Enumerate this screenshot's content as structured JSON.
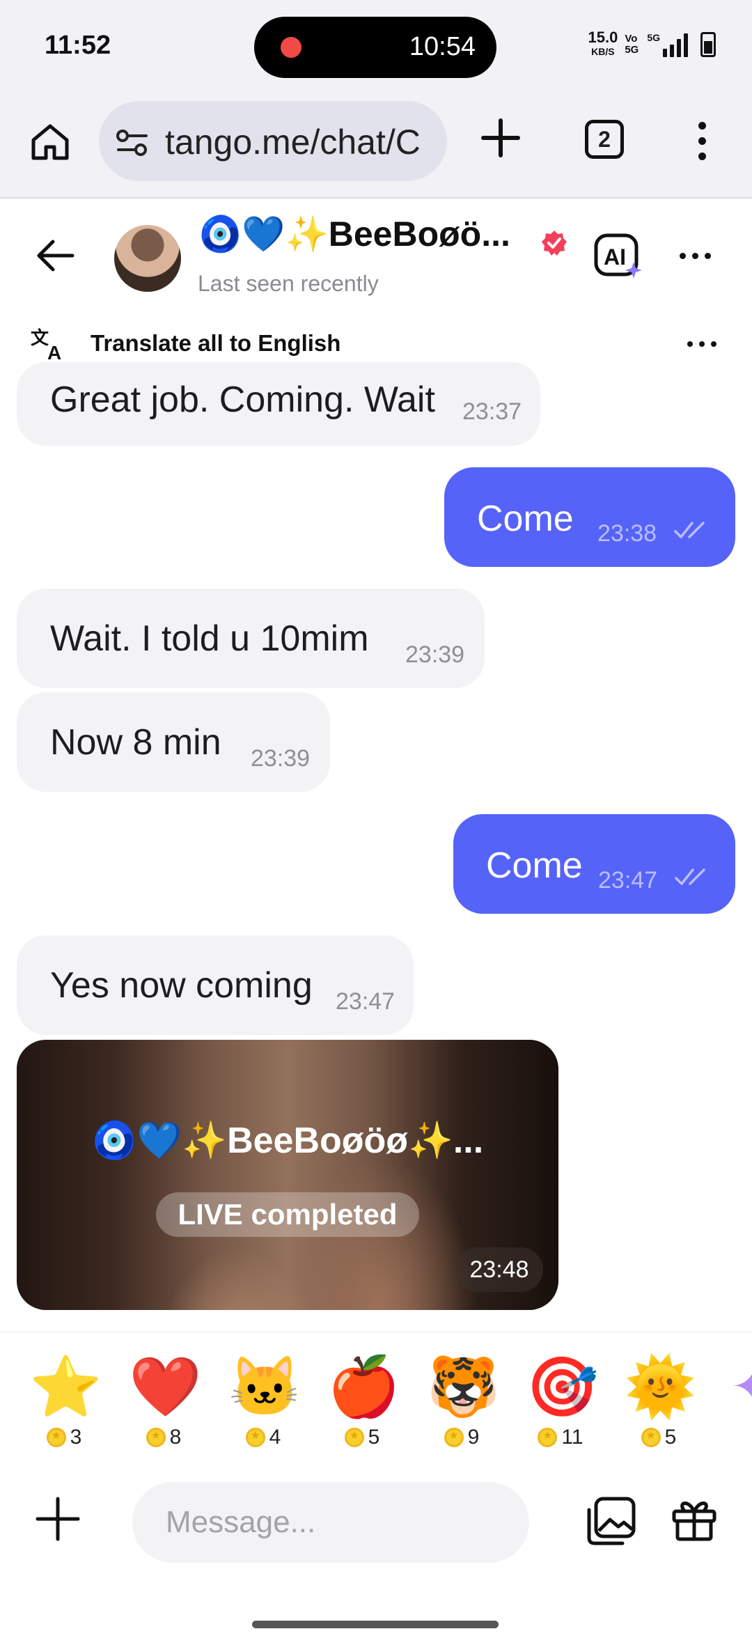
{
  "status_bar": {
    "time": "11:52",
    "island_time": "10:54",
    "net_speed": "15.0",
    "net_unit": "KB/S",
    "vo_label": "Vo 5G",
    "network": "5G"
  },
  "browser": {
    "url": "tango.me/chat/C",
    "tab_count": "2"
  },
  "chat": {
    "contact_name": "🧿💙✨BeeBoøö...",
    "status": "Last seen recently",
    "translate_label": "Translate all to English",
    "messages": [
      {
        "dir": "in",
        "text": "Great job. Coming. Wait",
        "time": "23:37"
      },
      {
        "dir": "out",
        "text": "Come",
        "time": "23:38"
      },
      {
        "dir": "in",
        "text": "Wait. I told u 10mim",
        "time": "23:39"
      },
      {
        "dir": "in",
        "text": "Now 8 min",
        "time": "23:39"
      },
      {
        "dir": "out",
        "text": "Come",
        "time": "23:47"
      },
      {
        "dir": "in",
        "text": "Yes now coming",
        "time": "23:47"
      }
    ],
    "live_card": {
      "name": "🧿💙✨BeeBoøöø✨...",
      "label": "LIVE completed",
      "time": "23:48"
    }
  },
  "gifts": [
    {
      "icon": "star-gift",
      "emoji": "⭐",
      "price": "3"
    },
    {
      "icon": "heart-gift",
      "emoji": "❤️",
      "price": "8"
    },
    {
      "icon": "cat-gift",
      "emoji": "🐱",
      "price": "4"
    },
    {
      "icon": "apple-gift",
      "emoji": "🍎",
      "price": "5"
    },
    {
      "icon": "tiger-gift",
      "emoji": "🐯",
      "price": "9"
    },
    {
      "icon": "target-gift",
      "emoji": "🎯",
      "price": "11"
    },
    {
      "icon": "sun-gift",
      "emoji": "🌞",
      "price": "5"
    }
  ],
  "composer": {
    "placeholder": "Message..."
  },
  "colors": {
    "outgoing_bubble": "#5663f9",
    "incoming_bubble": "#f3f3f5",
    "verified_badge": "#f2405a",
    "ai_sparkle": "#8a7cf9"
  }
}
